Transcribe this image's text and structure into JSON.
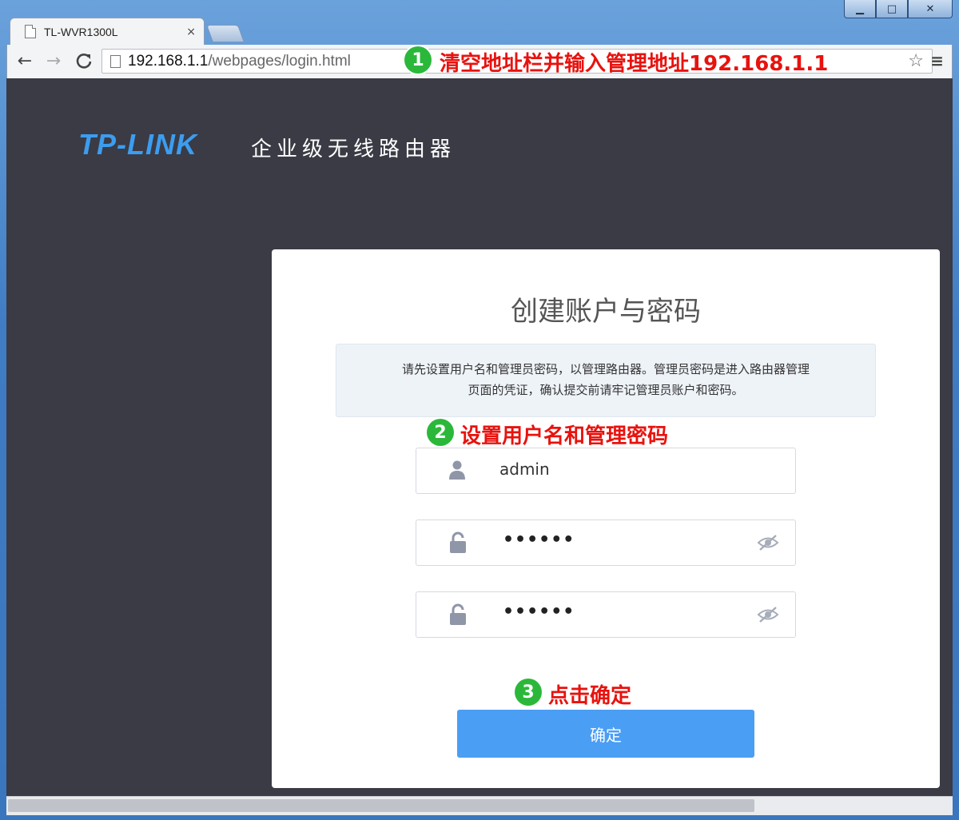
{
  "window": {
    "minimize": "▁",
    "maximize": "□",
    "close": "✕"
  },
  "tab": {
    "title": "TL-WVR1300L",
    "close": "×"
  },
  "toolbar": {
    "back": "←",
    "forward": "→",
    "reload": "C",
    "url_host": "192.168.1.1",
    "url_path": "/webpages/login.html",
    "star": "☆",
    "menu": "≡"
  },
  "annotations": [
    {
      "num": "1",
      "text": "清空地址栏并输入管理地址192.168.1.1"
    },
    {
      "num": "2",
      "text": "设置用户名和管理密码"
    },
    {
      "num": "3",
      "text": "点击确定"
    }
  ],
  "header": {
    "logo": "TP-LINK",
    "product": "企业级无线路由器"
  },
  "card": {
    "title": "创建账户与密码",
    "notice_line1": "请先设置用户名和管理员密码，以管理路由器。管理员密码是进入路由器管理",
    "notice_line2": "页面的凭证，确认提交前请牢记管理员账户和密码。",
    "username": "admin",
    "password": "••••••",
    "password_confirm": "••••••",
    "confirm_label": "确定"
  },
  "colors": {
    "accent": "#4a9ef4",
    "annotation_red": "#e8120e",
    "annotation_badge": "#2bb83a",
    "page_bg": "#3a3b45"
  }
}
